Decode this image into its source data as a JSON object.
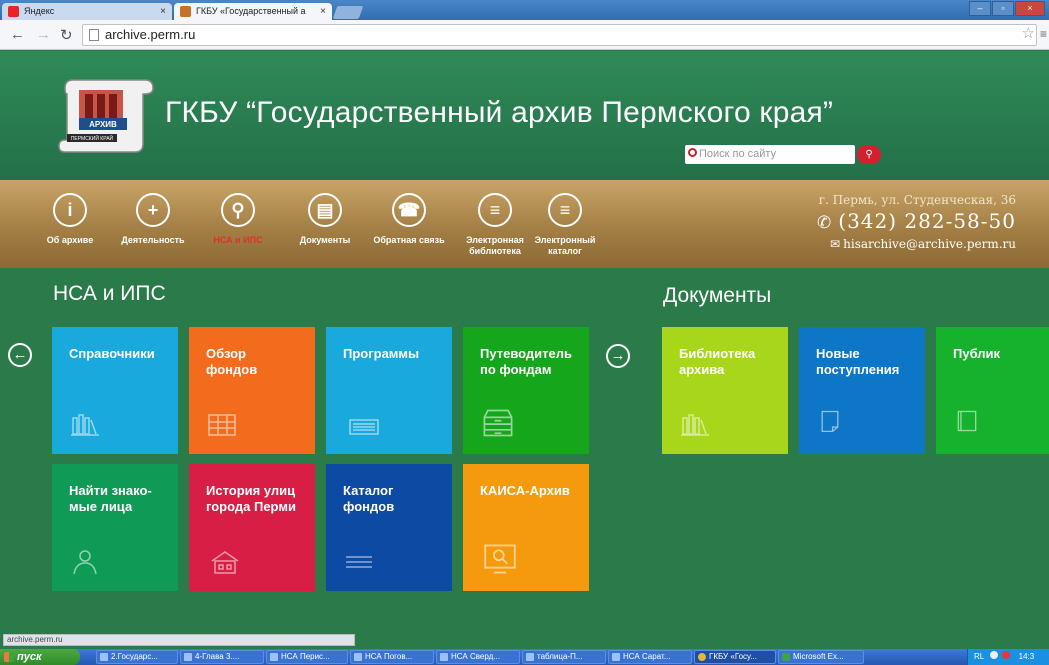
{
  "browser": {
    "tabs": [
      {
        "label": "Яндекс",
        "active": false
      },
      {
        "label": "ГКБУ «Государственный а",
        "active": true
      }
    ],
    "url": "archive.perm.ru",
    "status_url": "archive.perm.ru"
  },
  "site": {
    "logo_text": "ПЕРМСКИЙ КРАЙ АРХИВ",
    "title": "ГКБУ “Государственный архив Пермского края”",
    "search_placeholder": "Поиск по сайту"
  },
  "nav": {
    "items": [
      {
        "label": "Об архиве",
        "icon": "i"
      },
      {
        "label": "Деятельность",
        "icon": "+"
      },
      {
        "label": "НСА и ИПС",
        "icon": "⚲"
      },
      {
        "label": "Документы",
        "icon": "▤"
      },
      {
        "label": "Обратная связь",
        "icon": "☎"
      },
      {
        "label": "Электронная библиотека",
        "icon": "≡"
      },
      {
        "label": "Электронный каталог",
        "icon": "≡"
      }
    ],
    "active_index": 2
  },
  "contacts": {
    "address": "г. Пермь, ул. Студенческая, 36",
    "phone": "(342) 282-58-50",
    "email": "hisarchive@archive.perm.ru"
  },
  "sections": {
    "nsa": {
      "title": "НСА и ИПС",
      "tiles": [
        {
          "label": "Справочники",
          "color": "#1aa9dc",
          "icon": "books-icon"
        },
        {
          "label": "Обзор\nфондов",
          "color": "#f36b1c",
          "icon": "grid-icon"
        },
        {
          "label": "Программы",
          "color": "#1aa9dc",
          "icon": "keyboard-icon"
        },
        {
          "label": "Путеводитель\nпо фондам",
          "color": "#15a61b",
          "icon": "cabinet-icon"
        },
        {
          "label": "Найти знако-\nмые лица",
          "color": "#0f9a56",
          "icon": "person-icon"
        },
        {
          "label": "История улиц\nгорода Перми",
          "color": "#d81e45",
          "icon": "house-icon"
        },
        {
          "label": "Каталог\nфондов",
          "color": "#0c4aa3",
          "icon": "list-icon"
        },
        {
          "label": "КАИСА-Архив",
          "color": "#f59a0c",
          "icon": "monitor-icon"
        }
      ]
    },
    "docs": {
      "title": "Документы",
      "tiles": [
        {
          "label": "Библиотека\nархива",
          "color": "#a7d61b",
          "icon": "books-icon"
        },
        {
          "label": "Новые\nпоступления",
          "color": "#0e76c6",
          "icon": "document-icon"
        },
        {
          "label": "Публик",
          "color": "#16b22d",
          "icon": "book-icon"
        }
      ]
    }
  },
  "taskbar": {
    "start_label": "пуск",
    "items": [
      "2.Государс...",
      "4-Глава 3....",
      "НСА Перис...",
      "НСА Погов...",
      "НСА Сверд...",
      "таблица-П...",
      "НСА Сарат...",
      "ГКБУ «Госу...",
      "Microsoft Ex..."
    ],
    "tray_text": "RL",
    "clock": "14:3"
  }
}
